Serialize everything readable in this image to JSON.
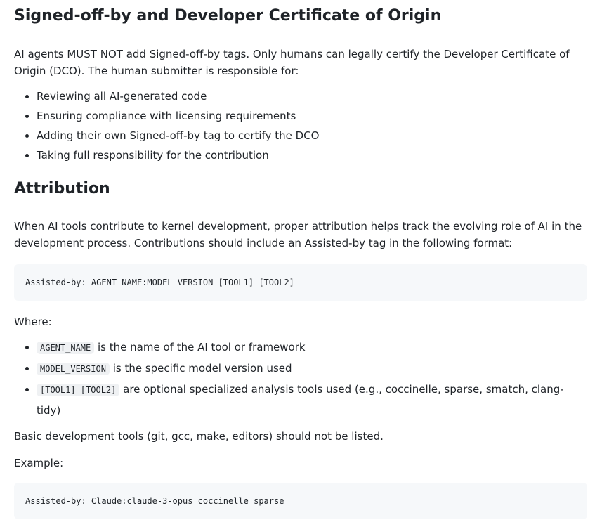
{
  "dco": {
    "heading": "Signed-off-by and Developer Certificate of Origin",
    "intro": "AI agents MUST NOT add Signed-off-by tags. Only humans can legally certify the Developer Certificate of Origin (DCO). The human submitter is responsible for:",
    "items": [
      "Reviewing all AI-generated code",
      "Ensuring compliance with licensing requirements",
      "Adding their own Signed-off-by tag to certify the DCO",
      "Taking full responsibility for the contribution"
    ]
  },
  "attribution": {
    "heading": "Attribution",
    "intro": "When AI tools contribute to kernel development, proper attribution helps track the evolving role of AI in the development process. Contributions should include an Assisted-by tag in the following format:",
    "format_code": "Assisted-by: AGENT_NAME:MODEL_VERSION [TOOL1] [TOOL2]",
    "where_label": "Where:",
    "where_items": [
      {
        "code": "AGENT_NAME",
        "text": " is the name of the AI tool or framework"
      },
      {
        "code": "MODEL_VERSION",
        "text": " is the specific model version used"
      },
      {
        "code": "[TOOL1] [TOOL2]",
        "text": " are optional specialized analysis tools used (e.g., coccinelle, sparse, smatch, clang-tidy)"
      }
    ],
    "basic_tools": "Basic development tools (git, gcc, make, editors) should not be listed.",
    "example_label": "Example:",
    "example_code": "Assisted-by: Claude:claude-3-opus coccinelle sparse"
  }
}
